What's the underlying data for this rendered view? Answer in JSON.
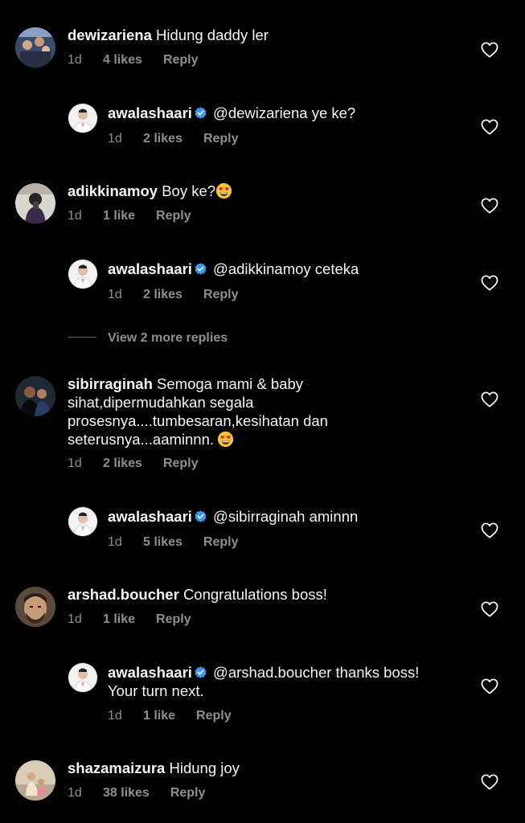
{
  "comments": [
    {
      "username": "dewizariena",
      "text": "Hidung daddy ler",
      "time": "1d",
      "likes": "4 likes",
      "reply": "Reply"
    },
    {
      "username": "awalashaari",
      "text": "@dewizariena ye ke?",
      "time": "1d",
      "likes": "2 likes",
      "reply": "Reply"
    },
    {
      "username": "adikkinamoy",
      "text": "Boy ke?",
      "time": "1d",
      "likes": "1 like",
      "reply": "Reply"
    },
    {
      "username": "awalashaari",
      "text": "@adikkinamoy ceteka",
      "time": "1d",
      "likes": "2 likes",
      "reply": "Reply"
    },
    {
      "username": "sibirraginah",
      "text": "Semoga mami & baby sihat,dipermudahkan segala prosesnya....tumbesaran,kesihatan dan seterusnya...aaminnn.",
      "time": "1d",
      "likes": "2 likes",
      "reply": "Reply"
    },
    {
      "username": "awalashaari",
      "text": "@sibirraginah aminnn",
      "time": "1d",
      "likes": "5 likes",
      "reply": "Reply"
    },
    {
      "username": "arshad.boucher",
      "text": "Congratulations boss!",
      "time": "1d",
      "likes": "1 like",
      "reply": "Reply"
    },
    {
      "username": "awalashaari",
      "text": "@arshad.boucher thanks boss! Your turn next.",
      "time": "1d",
      "likes": "1 like",
      "reply": "Reply"
    },
    {
      "username": "shazamaizura",
      "text": "Hidung joy",
      "time": "1d",
      "likes": "38 likes",
      "reply": "Reply"
    }
  ],
  "view_more": "View 2 more replies",
  "icons": {
    "heart": "heart-outline-icon",
    "verified": "verified-badge-icon",
    "emoji": "heart-eyes-emoji"
  },
  "colors": {
    "background": "#000000",
    "text": "#f5f5f5",
    "secondary": "#8e8e8e",
    "verified": "#3897f0"
  }
}
